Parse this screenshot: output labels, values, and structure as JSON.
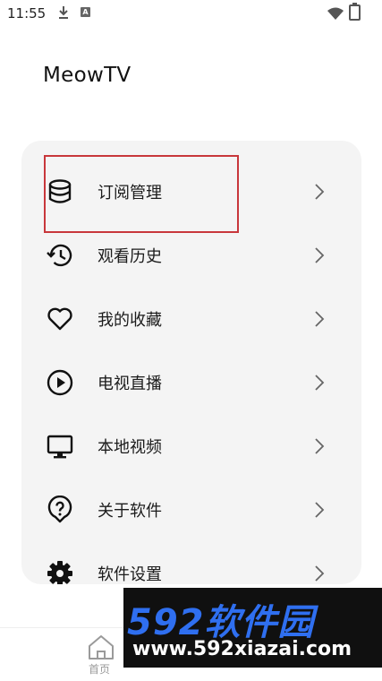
{
  "status_bar": {
    "time": "11:55"
  },
  "app": {
    "title": "MeowTV"
  },
  "menu": {
    "items": [
      {
        "label": "订阅管理",
        "icon": "database-icon"
      },
      {
        "label": "观看历史",
        "icon": "history-icon"
      },
      {
        "label": "我的收藏",
        "icon": "heart-icon"
      },
      {
        "label": "电视直播",
        "icon": "play-circle-icon"
      },
      {
        "label": "本地视频",
        "icon": "monitor-icon"
      },
      {
        "label": "关于软件",
        "icon": "help-icon"
      },
      {
        "label": "软件设置",
        "icon": "gear-icon"
      }
    ]
  },
  "bottom_nav": {
    "home_label": "首页"
  },
  "watermark": {
    "line1": "592软件园",
    "line2": "www.592xiazai.com"
  },
  "colors": {
    "highlight": "#c8373b",
    "card_bg": "#f4f4f4",
    "watermark_blue": "#2f6ff0"
  }
}
